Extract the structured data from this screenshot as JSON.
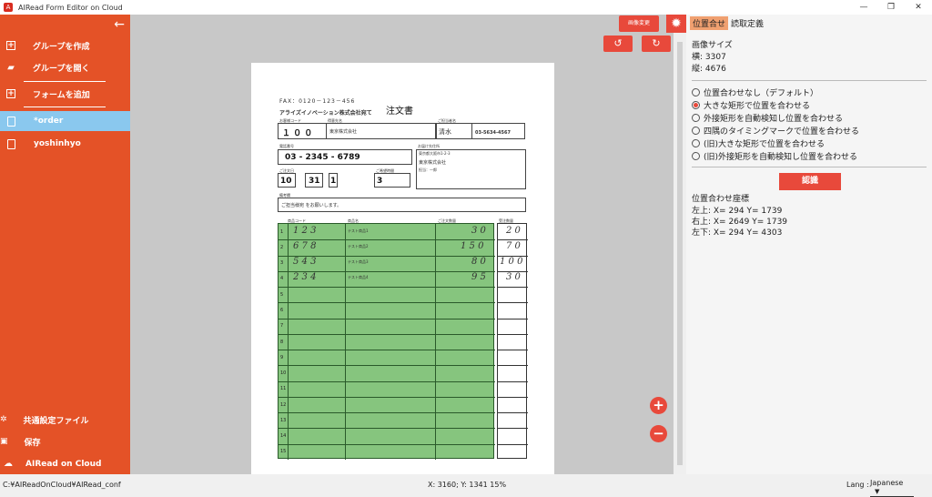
{
  "window": {
    "title": "AIRead Form Editor on Cloud"
  },
  "sidebar": {
    "create_group": "グループを作成",
    "open_group": "グループを開く",
    "add_form": "フォームを追加",
    "files": [
      "*order",
      "yoshinhyo"
    ],
    "common_settings": "共通設定ファイル",
    "save": "保存",
    "logo": "AIRead on Cloud"
  },
  "toolbar": {
    "change_image": "画像変更"
  },
  "document": {
    "fax": "FAX：0120－123－456",
    "company": "アライズイノベーション株式会社宛て",
    "title": "注文書",
    "customer_code_label": "お客様コード",
    "customer_name_label": "得意先名",
    "person_label": "ご担当者名",
    "tel_label": "TEL",
    "customer_code": "１ ０ ０",
    "customer_name": "東京株式会社",
    "person": "清水",
    "tel": "03-5634-4567",
    "phone_label": "電話番号",
    "phone": "03 - 2345 - 6789",
    "delivery_label": "お届け先住所",
    "delivery_name": "東京都大阪市1-2-3",
    "delivery_company": "東京株式会社",
    "delivery_person": "担当：一郎",
    "date_label": "ご注文日",
    "date_vals": [
      "10",
      "31",
      "1"
    ],
    "hope_label": "ご希望時間",
    "hope_val": "3",
    "remarks_label": "備考欄",
    "remarks": "ご担当様宛 をお願いします。",
    "col_headers": [
      "商品コード",
      "商品名",
      "ご注文数量",
      "受注数量"
    ],
    "rows": [
      {
        "code": "1 2 3",
        "name": "テスト商品1",
        "qty": "3 0",
        "recv": "2 0"
      },
      {
        "code": "6 7 8",
        "name": "テスト商品2",
        "qty": "1 5 0",
        "recv": "7 0"
      },
      {
        "code": "5 4 3",
        "name": "テスト商品3",
        "qty": "8 0",
        "recv": "1 0 0"
      },
      {
        "code": "2 3 4",
        "name": "テスト商品4",
        "qty": "9 5",
        "recv": "3 0"
      }
    ],
    "row_numbers": [
      "1",
      "2",
      "3",
      "4",
      "5",
      "6",
      "7",
      "8",
      "9",
      "10",
      "11",
      "12",
      "13",
      "14",
      "15"
    ]
  },
  "right_panel": {
    "tabs": [
      "位置合せ",
      "読取定義"
    ],
    "image_size_label": "画像サイズ",
    "width": "横: 3307",
    "height": "縦: 4676",
    "options": [
      "位置合わせなし（デフォルト）",
      "大きな矩形で位置を合わせる",
      "外接矩形を自動検知し位置を合わせる",
      "四隅のタイミングマークで位置を合わせる",
      "(旧)大きな矩形で位置を合わせる",
      "(旧)外接矩形を自動検知し位置を合わせる"
    ],
    "selected_index": 1,
    "recognize_button": "認識",
    "coords_label": "位置合わせ座標",
    "coords": [
      "左上: X= 294   Y= 1739",
      "右上: X= 2649   Y= 1739",
      "左下: X= 294   Y= 4303"
    ]
  },
  "status": {
    "path": "C:¥AIReadOnCloud¥AIRead_conf",
    "pos": "X: 3160; Y: 1341   15%",
    "lang_label": "Lang :",
    "lang": "Japanese"
  },
  "colors": {
    "accent": "#e45227",
    "button": "#e8493b",
    "selected": "#8ac8ee",
    "grid": "#86c57e"
  }
}
